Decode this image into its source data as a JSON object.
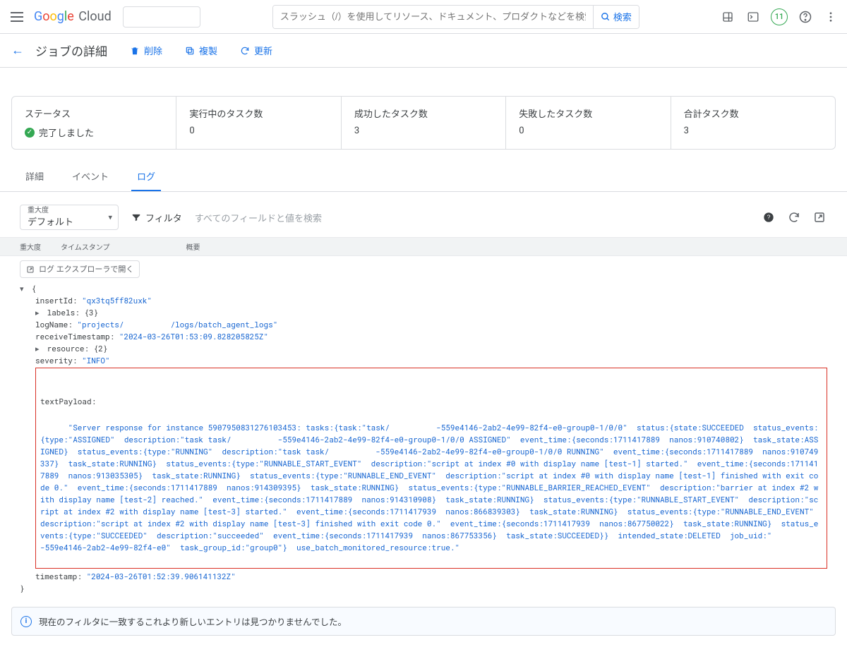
{
  "header": {
    "search_placeholder": "スラッシュ（/）を使用してリソース、ドキュメント、プロダクトなどを検索",
    "search_button": "検索",
    "trial_badge": "11"
  },
  "page": {
    "title": "ジョブの詳細",
    "delete": "削除",
    "clone": "複製",
    "refresh": "更新"
  },
  "status": {
    "label": "ステータス",
    "value": "完了しました",
    "running_label": "実行中のタスク数",
    "running_value": "0",
    "succeeded_label": "成功したタスク数",
    "succeeded_value": "3",
    "failed_label": "失敗したタスク数",
    "failed_value": "0",
    "total_label": "合計タスク数",
    "total_value": "3"
  },
  "tabs": {
    "details": "詳細",
    "events": "イベント",
    "logs": "ログ"
  },
  "logtoolbar": {
    "severity_label": "重大度",
    "severity_value": "デフォルト",
    "filter": "フィルタ",
    "filter_placeholder": "すべてのフィールドと値を検索"
  },
  "logheaders": {
    "severity": "重大度",
    "timestamp": "タイムスタンプ",
    "summary": "概要"
  },
  "log": {
    "open_explorer": "ログ エクスプローラで開く",
    "insertId": "qx3tq5ff82uxk",
    "labels": "{3}",
    "logName": "projects/          /logs/batch_agent_logs",
    "receiveTimestamp": "2024-03-26T01:53:09.828205825Z",
    "resource": "{2}",
    "severity": "INFO",
    "timestamp": "2024-03-26T01:52:39.906141132Z",
    "textPayload": "\"Server response for instance 5907950831276103453: tasks:{task:\"task/          -559e4146-2ab2-4e99-82f4-e0-group0-1/0/0\"  status:{state:SUCCEEDED  status_events:{type:\"ASSIGNED\"  description:\"task task/          -559e4146-2ab2-4e99-82f4-e0-group0-1/0/0 ASSIGNED\"  event_time:{seconds:1711417889  nanos:910740802}  task_state:ASSIGNED}  status_events:{type:\"RUNNING\"  description:\"task task/          -559e4146-2ab2-4e99-82f4-e0-group0-1/0/0 RUNNING\"  event_time:{seconds:1711417889  nanos:910749337}  task_state:RUNNING}  status_events:{type:\"RUNNABLE_START_EVENT\"  description:\"script at index #0 with display name [test-1] started.\"  event_time:{seconds:1711417889  nanos:913035305}  task_state:RUNNING}  status_events:{type:\"RUNNABLE_END_EVENT\"  description:\"script at index #0 with display name [test-1] finished with exit code 0.\"  event_time:{seconds:1711417889  nanos:914309395}  task_state:RUNNING}  status_events:{type:\"RUNNABLE_BARRIER_REACHED_EVENT\"  description:\"barrier at index #2 with display name [test-2] reached.\"  event_time:{seconds:1711417889  nanos:914310908}  task_state:RUNNING}  status_events:{type:\"RUNNABLE_START_EVENT\"  description:\"script at index #2 with display name [test-3] started.\"  event_time:{seconds:1711417939  nanos:866839303}  task_state:RUNNING}  status_events:{type:\"RUNNABLE_END_EVENT\"  description:\"script at index #2 with display name [test-3] finished with exit code 0.\"  event_time:{seconds:1711417939  nanos:867750022}  task_state:RUNNING}  status_events:{type:\"SUCCEEDED\"  description:\"succeeded\"  event_time:{seconds:1711417939  nanos:867753356}  task_state:SUCCEEDED}}  intended_state:DELETED  job_uid:\"          -559e4146-2ab2-4e99-82f4-e0\"  task_group_id:\"group0\"}  use_batch_monitored_resource:true.\""
  },
  "banner": "現在のフィルタに一致するこれより新しいエントリは見つかりませんでした。"
}
